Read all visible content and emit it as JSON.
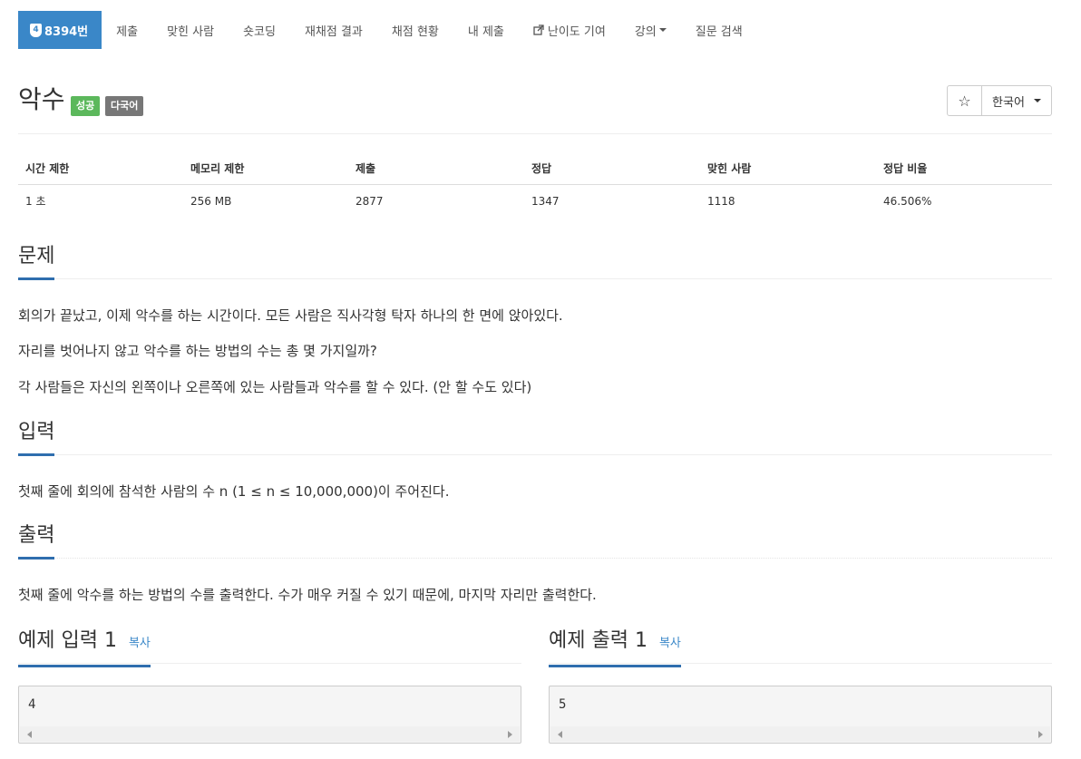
{
  "nav": {
    "problem_id": "8394번",
    "tier_icon": "tier-badge-icon",
    "items": [
      "제출",
      "맞힌 사람",
      "숏코딩",
      "재채점 결과",
      "채점 현황",
      "내 제출",
      "난이도 기여",
      "강의",
      "질문 검색"
    ]
  },
  "problem": {
    "title": "악수",
    "labels": {
      "success": "성공",
      "multilang": "다국어"
    },
    "star": "☆",
    "language": "한국어"
  },
  "info_table": {
    "headers": [
      "시간 제한",
      "메모리 제한",
      "제출",
      "정답",
      "맞힌 사람",
      "정답 비율"
    ],
    "values": [
      "1 초",
      "256 MB",
      "2877",
      "1347",
      "1118",
      "46.506%"
    ]
  },
  "sections": {
    "problem": {
      "title": "문제",
      "paragraphs": [
        "회의가 끝났고, 이제 악수를 하는 시간이다. 모든 사람은 직사각형 탁자 하나의 한 면에 앉아있다.",
        "자리를 벗어나지 않고 악수를 하는 방법의 수는 총 몇 가지일까?",
        "각 사람들은 자신의 왼쪽이나 오른쪽에 있는 사람들과 악수를 할 수 있다. (안 할 수도 있다)"
      ]
    },
    "input": {
      "title": "입력",
      "text": "첫째 줄에 회의에 참석한 사람의 수 n (1 ≤ n ≤ 10,000,000)이 주어진다."
    },
    "output": {
      "title": "출력",
      "text": "첫째 줄에 악수를 하는 방법의 수를 출력한다. 수가 매우 커질 수 있기 때문에, 마지막 자리만 출력한다."
    }
  },
  "samples": {
    "copy_label": "복사",
    "input": {
      "title": "예제 입력 1",
      "content": "4"
    },
    "output": {
      "title": "예제 출력 1",
      "content": "5"
    }
  },
  "colors": {
    "accent": "#3a87c8",
    "success": "#5cb85c",
    "label_gray": "#777777",
    "section_underline": "#2f6eae"
  }
}
